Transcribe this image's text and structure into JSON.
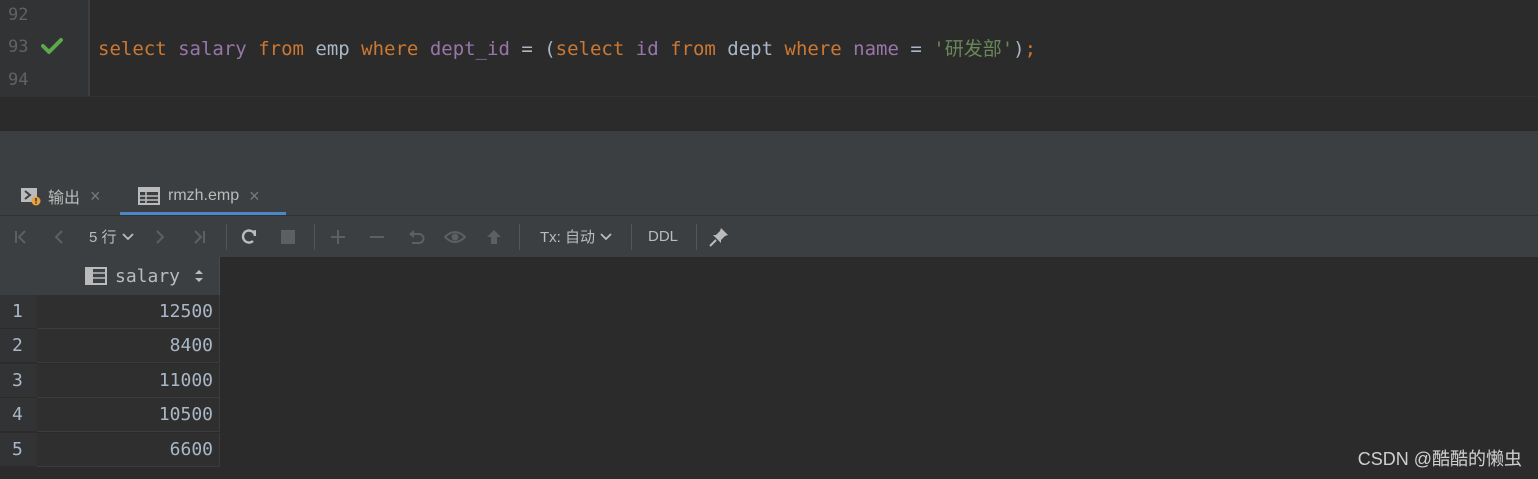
{
  "editor": {
    "line_numbers": [
      "92",
      "93",
      "94"
    ],
    "run_status_icon": "check-icon",
    "code": {
      "t1": "select",
      "t2": " ",
      "t3": "salary",
      "t4": " ",
      "t5": "from",
      "t6": " emp ",
      "t7": "where",
      "t8": " ",
      "t9": "dept_id",
      "t10": " = (",
      "t11": "select",
      "t12": " ",
      "t13": "id",
      "t14": " ",
      "t15": "from",
      "t16": " dept ",
      "t17": "where",
      "t18": " ",
      "t19": "name",
      "t20": " = ",
      "t21": "'研发部'",
      "t22": ")",
      "t23": ";"
    }
  },
  "tabs": [
    {
      "label": "输出",
      "icon": "console-icon",
      "close": "×"
    },
    {
      "label": "rmzh.emp",
      "icon": "table-icon",
      "close": "×"
    }
  ],
  "toolbar": {
    "rows_label": "5 行",
    "tx_label": "Tx: 自动",
    "ddl_label": "DDL"
  },
  "grid": {
    "column": "salary",
    "rows": [
      {
        "n": "1",
        "salary": "12500"
      },
      {
        "n": "2",
        "salary": "8400"
      },
      {
        "n": "3",
        "salary": "11000"
      },
      {
        "n": "4",
        "salary": "10500"
      },
      {
        "n": "5",
        "salary": "6600"
      }
    ]
  },
  "watermark": "CSDN @酷酷的懒虫",
  "colors": {
    "keyword": "#cc7832",
    "column": "#9876aa",
    "string": "#6a8759",
    "check": "#5ea74d",
    "tab_underline": "#4a88c7"
  }
}
